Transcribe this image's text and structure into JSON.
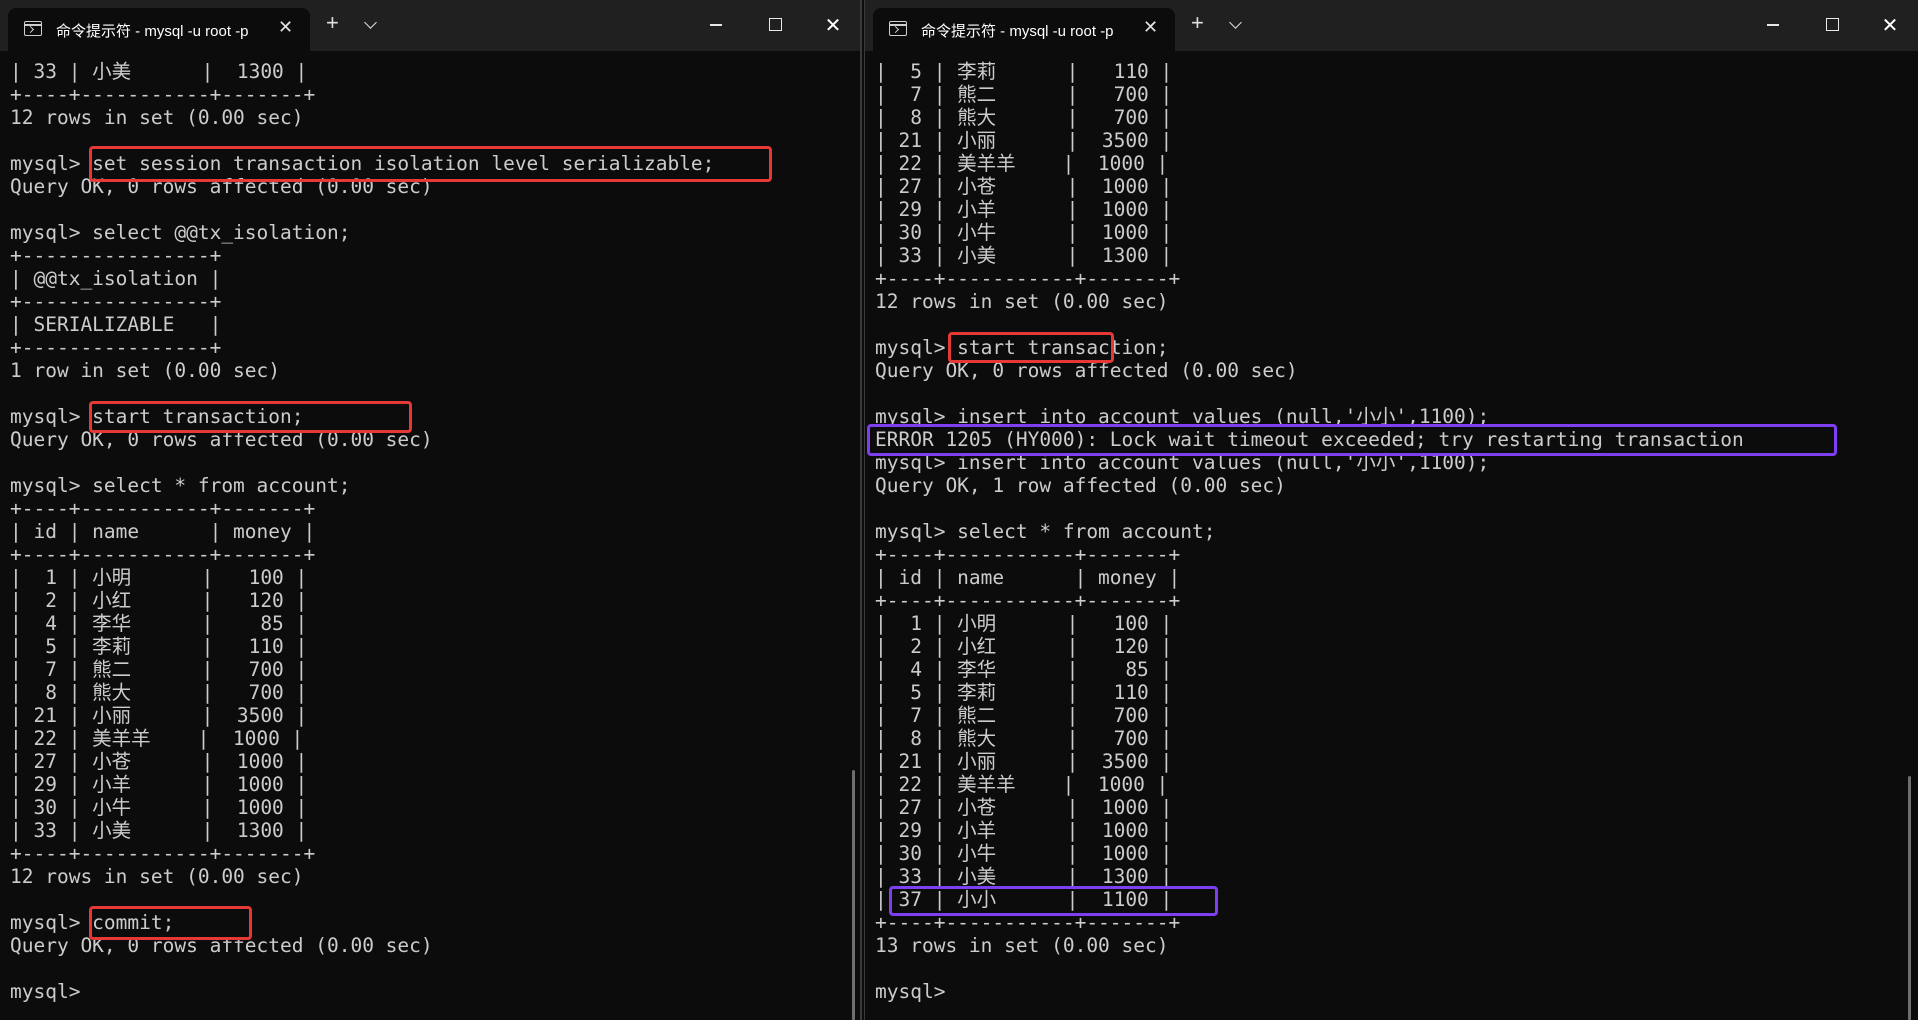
{
  "left_window": {
    "tab_title": "命令提示符 - mysql  -u root -p",
    "tab_close": "✕",
    "new_tab": "+",
    "close_glyph": "✕",
    "lines": [
      "| 33 | 小美      |  1300 |",
      "+----+-----------+-------+",
      "12 rows in set (0.00 sec)",
      "",
      "mysql> set session transaction isolation level serializable;",
      "Query OK, 0 rows affected (0.00 sec)",
      "",
      "mysql> select @@tx_isolation;",
      "+----------------+",
      "| @@tx_isolation |",
      "+----------------+",
      "| SERIALIZABLE   |",
      "+----------------+",
      "1 row in set (0.00 sec)",
      "",
      "mysql> start transaction;",
      "Query OK, 0 rows affected (0.00 sec)",
      "",
      "mysql> select * from account;",
      "+----+-----------+-------+",
      "| id | name      | money |",
      "+----+-----------+-------+",
      "|  1 | 小明      |   100 |",
      "|  2 | 小红      |   120 |",
      "|  4 | 李华      |    85 |",
      "|  5 | 李莉      |   110 |",
      "|  7 | 熊二      |   700 |",
      "|  8 | 熊大      |   700 |",
      "| 21 | 小丽      |  3500 |",
      "| 22 | 美羊羊    |  1000 |",
      "| 27 | 小苍      |  1000 |",
      "| 29 | 小羊      |  1000 |",
      "| 30 | 小牛      |  1000 |",
      "| 33 | 小美      |  1300 |",
      "+----+-----------+-------+",
      "12 rows in set (0.00 sec)",
      "",
      "mysql> commit;",
      "Query OK, 0 rows affected (0.00 sec)",
      "",
      "mysql>"
    ]
  },
  "right_window": {
    "tab_title": "命令提示符 - mysql  -u root -p",
    "tab_close": "✕",
    "new_tab": "+",
    "close_glyph": "✕",
    "lines": [
      "|  5 | 李莉      |   110 |",
      "|  7 | 熊二      |   700 |",
      "|  8 | 熊大      |   700 |",
      "| 21 | 小丽      |  3500 |",
      "| 22 | 美羊羊    |  1000 |",
      "| 27 | 小苍      |  1000 |",
      "| 29 | 小羊      |  1000 |",
      "| 30 | 小牛      |  1000 |",
      "| 33 | 小美      |  1300 |",
      "+----+-----------+-------+",
      "12 rows in set (0.00 sec)",
      "",
      "mysql> start transaction;",
      "Query OK, 0 rows affected (0.00 sec)",
      "",
      "mysql> insert into account values (null,'小小',1100);",
      "ERROR 1205 (HY000): Lock wait timeout exceeded; try restarting transaction",
      "mysql> insert into account values (null,'小小',1100);",
      "Query OK, 1 row affected (0.00 sec)",
      "",
      "mysql> select * from account;",
      "+----+-----------+-------+",
      "| id | name      | money |",
      "+----+-----------+-------+",
      "|  1 | 小明      |   100 |",
      "|  2 | 小红      |   120 |",
      "|  4 | 李华      |    85 |",
      "|  5 | 李莉      |   110 |",
      "|  7 | 熊二      |   700 |",
      "|  8 | 熊大      |   700 |",
      "| 21 | 小丽      |  3500 |",
      "| 22 | 美羊羊    |  1000 |",
      "| 27 | 小苍      |  1000 |",
      "| 29 | 小羊      |  1000 |",
      "| 30 | 小牛      |  1000 |",
      "| 33 | 小美      |  1300 |",
      "| 37 | 小小      |  1100 |",
      "+----+-----------+-------+",
      "13 rows in set (0.00 sec)",
      "",
      "mysql>"
    ]
  },
  "colors": {
    "terminal_bg": "#0c0c0c",
    "terminal_text": "#cccccc",
    "titlebar_bg": "#202020",
    "highlight_red": "#e53935",
    "highlight_purple": "#7e3ff2"
  },
  "icons": {
    "tab_icon": "terminal-icon",
    "minimize": "minimize-icon",
    "maximize": "maximize-icon",
    "close": "close-icon",
    "dropdown": "chevron-down-icon"
  }
}
